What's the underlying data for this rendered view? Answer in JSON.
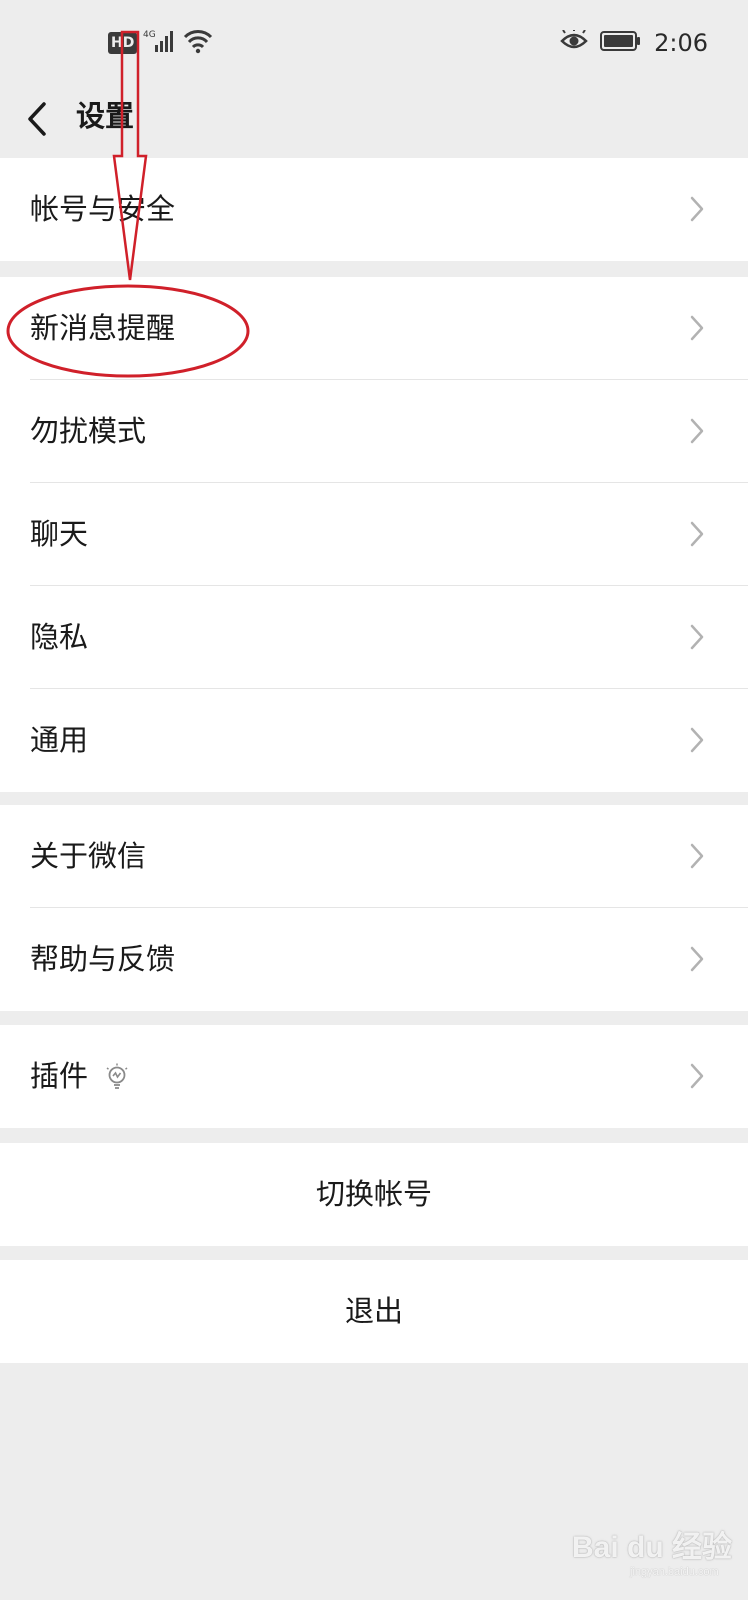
{
  "status_bar": {
    "hd_label": "HD",
    "network_label": "4G",
    "time": "2:06"
  },
  "nav": {
    "title": "设置"
  },
  "groups": {
    "account": {
      "items": [
        {
          "label": "帐号与安全"
        }
      ]
    },
    "main": {
      "items": [
        {
          "label": "新消息提醒"
        },
        {
          "label": "勿扰模式"
        },
        {
          "label": "聊天"
        },
        {
          "label": "隐私"
        },
        {
          "label": "通用"
        }
      ]
    },
    "about": {
      "items": [
        {
          "label": "关于微信"
        },
        {
          "label": "帮助与反馈"
        }
      ]
    },
    "plugins": {
      "items": [
        {
          "label": "插件",
          "icon": "lightbulb-icon"
        }
      ]
    }
  },
  "actions": {
    "switch_account": "切换帐号",
    "logout": "退出"
  },
  "watermark": {
    "text": "Bai du 经验",
    "sub": "jingyan.baidu.com"
  },
  "colors": {
    "background": "#ededed",
    "row_background": "#ffffff",
    "annotation_red": "#d0202a",
    "chevron": "#b2b2b2"
  }
}
